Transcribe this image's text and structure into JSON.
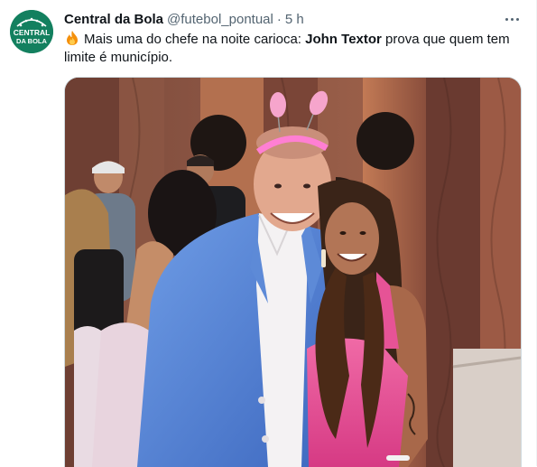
{
  "tweet": {
    "author_name": "Central da Bola",
    "author_handle": "@futebol_pontual",
    "separator": "·",
    "timestamp": "5 h",
    "text_part1": "Mais uma do chefe na noite carioca: ",
    "text_bold": "John Textor",
    "text_part2": " prova que quem tem limite é município.",
    "avatar_text_line1": "CENTRAL",
    "avatar_text_line2": "DA BOLA"
  },
  "colors": {
    "brand": "#13805f",
    "secondary_text": "#536471",
    "border": "#cfd9de"
  },
  "icons": [
    "fire-emoji-icon",
    "more-options-icon"
  ]
}
